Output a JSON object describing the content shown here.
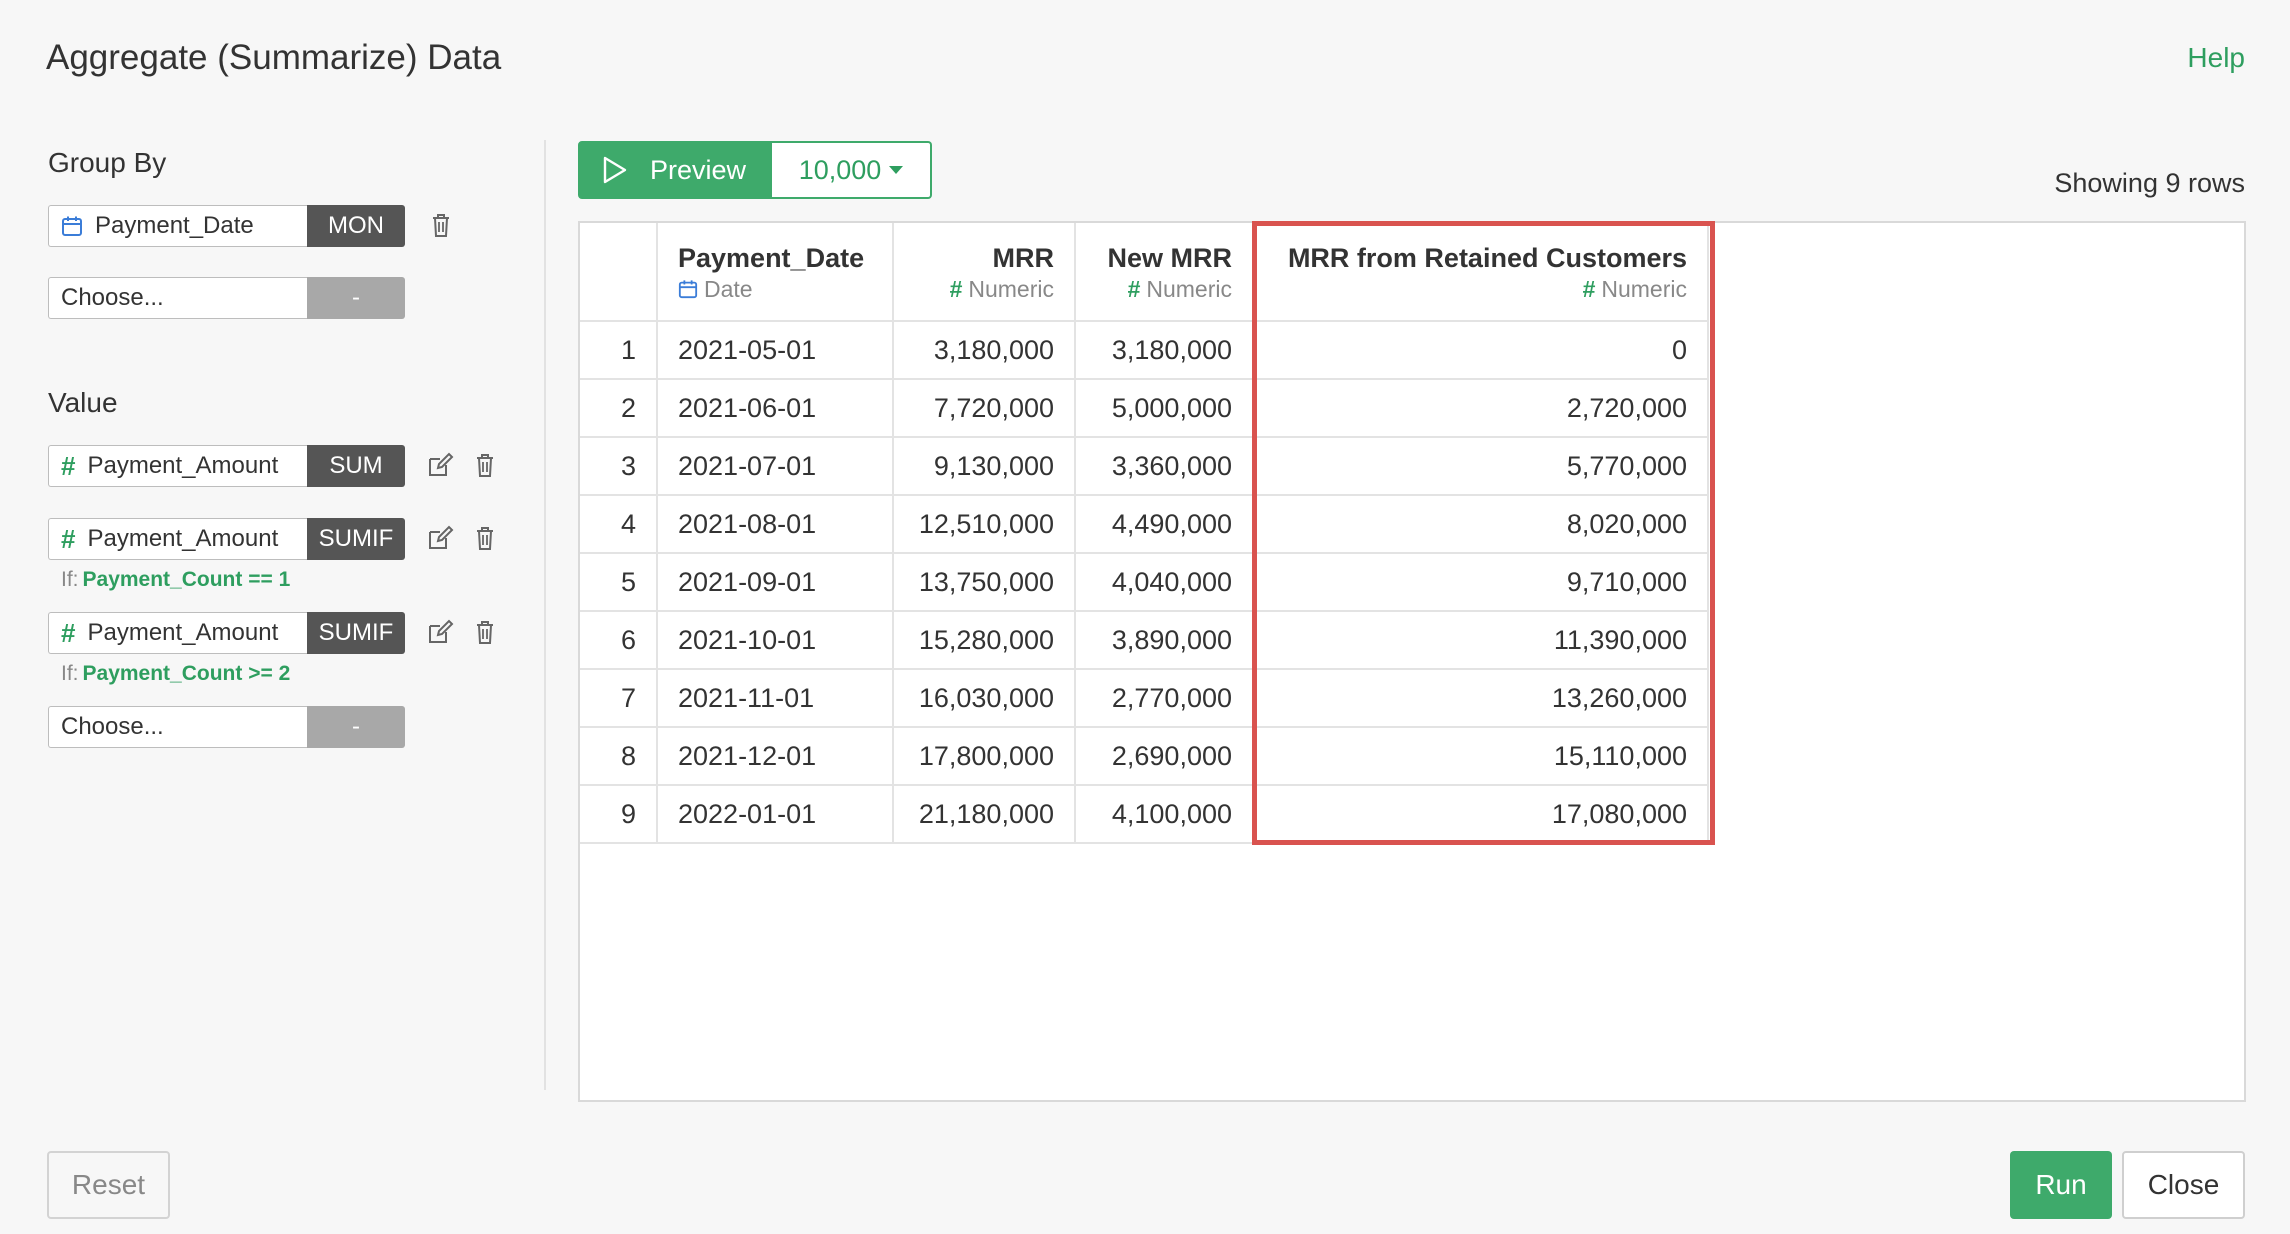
{
  "dialog": {
    "title": "Aggregate (Summarize) Data",
    "help_label": "Help"
  },
  "group_by": {
    "label": "Group By",
    "fields": [
      {
        "name": "Payment_Date",
        "agg": "MON",
        "icon": "calendar-icon"
      }
    ],
    "choose_placeholder": "Choose...",
    "choose_agg": "-"
  },
  "value": {
    "label": "Value",
    "fields": [
      {
        "name": "Payment_Amount",
        "agg": "SUM",
        "icon": "hash-icon",
        "condition_prefix": "",
        "condition": ""
      },
      {
        "name": "Payment_Amount",
        "agg": "SUMIF",
        "icon": "hash-icon",
        "condition_prefix": "If:",
        "condition": "Payment_Count == 1"
      },
      {
        "name": "Payment_Amount",
        "agg": "SUMIF",
        "icon": "hash-icon",
        "condition_prefix": "If:",
        "condition": "Payment_Count >= 2"
      }
    ],
    "choose_placeholder": "Choose...",
    "choose_agg": "-"
  },
  "preview": {
    "button_label": "Preview",
    "rows_limit": "10,000",
    "showing_text": "Showing 9 rows"
  },
  "table": {
    "columns": [
      {
        "name": "Payment_Date",
        "type": "Date"
      },
      {
        "name": "MRR",
        "type": "Numeric"
      },
      {
        "name": "New MRR",
        "type": "Numeric"
      },
      {
        "name": "MRR from Retained Customers",
        "type": "Numeric"
      }
    ],
    "rows": [
      [
        "1",
        "2021-05-01",
        "3,180,000",
        "3,180,000",
        "0"
      ],
      [
        "2",
        "2021-06-01",
        "7,720,000",
        "5,000,000",
        "2,720,000"
      ],
      [
        "3",
        "2021-07-01",
        "9,130,000",
        "3,360,000",
        "5,770,000"
      ],
      [
        "4",
        "2021-08-01",
        "12,510,000",
        "4,490,000",
        "8,020,000"
      ],
      [
        "5",
        "2021-09-01",
        "13,750,000",
        "4,040,000",
        "9,710,000"
      ],
      [
        "6",
        "2021-10-01",
        "15,280,000",
        "3,890,000",
        "11,390,000"
      ],
      [
        "7",
        "2021-11-01",
        "16,030,000",
        "2,770,000",
        "13,260,000"
      ],
      [
        "8",
        "2021-12-01",
        "17,800,000",
        "2,690,000",
        "15,110,000"
      ],
      [
        "9",
        "2022-01-01",
        "21,180,000",
        "4,100,000",
        "17,080,000"
      ]
    ],
    "highlight_color": "#d9534f"
  },
  "footer": {
    "reset_label": "Reset",
    "run_label": "Run",
    "close_label": "Close"
  },
  "colors": {
    "accent": "#3eaa6b",
    "agg_tag": "#555555",
    "highlight": "#d9534f"
  }
}
